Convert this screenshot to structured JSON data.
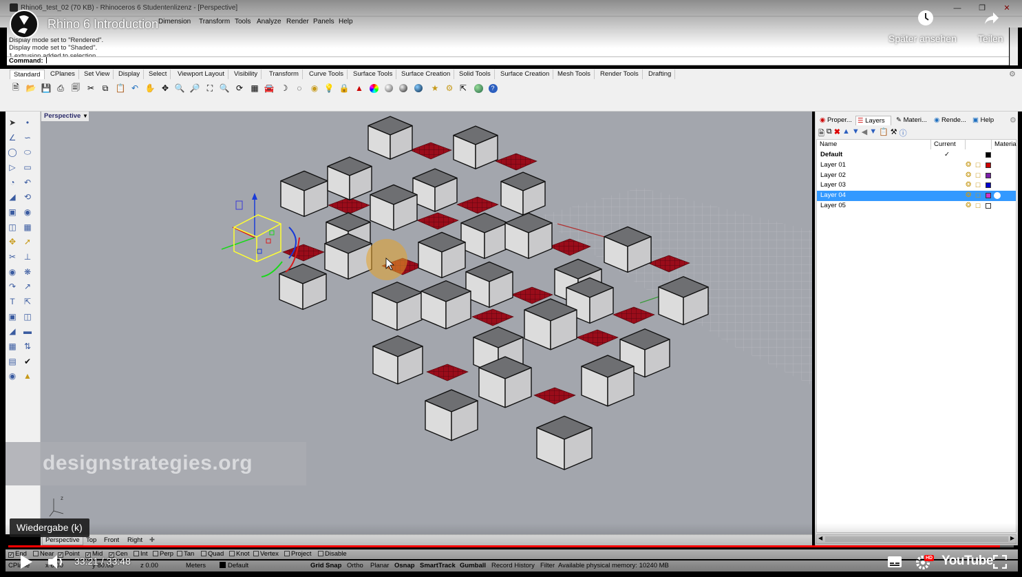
{
  "rhino": {
    "window_title": "Rhino6_test_02 (70 KB) - Rhinoceros 6 Studentenlizenz - [Perspective]",
    "menu": [
      "Dimension",
      "Transform",
      "Tools",
      "Analyze",
      "Render",
      "Panels",
      "Help"
    ],
    "command_history": [
      "Display mode set to \"Rendered\".",
      "Display mode set to \"Shaded\".",
      "1 extrusion added to selection."
    ],
    "command_label": "Command:",
    "toolbar_tabs": [
      "Standard",
      "CPlanes",
      "Set View",
      "Display",
      "Select",
      "Viewport Layout",
      "Visibility",
      "Transform",
      "Curve Tools",
      "Surface Tools",
      "Surface Creation",
      "Solid Tools",
      "Surface Creation",
      "Mesh Tools",
      "Render Tools",
      "Drafting"
    ],
    "active_toolbar_tab": "Standard",
    "viewport_label": "Perspective",
    "watermark": "designstrategies.org",
    "panel_tabs": [
      "Proper...",
      "Layers",
      "Materi...",
      "Rende...",
      "Help"
    ],
    "layer_columns": {
      "name": "Name",
      "current": "Current",
      "material": "Materia"
    },
    "layers": [
      {
        "name": "Default",
        "current": "✓",
        "color": "#000000",
        "bold": true
      },
      {
        "name": "Layer 01",
        "current": "",
        "color": "#cc0000"
      },
      {
        "name": "Layer 02",
        "current": "",
        "color": "#7a1fa8"
      },
      {
        "name": "Layer 03",
        "current": "",
        "color": "#0000cc"
      },
      {
        "name": "Layer 04",
        "current": "",
        "color": "#cc33cc",
        "selected": true
      },
      {
        "name": "Layer 05",
        "current": "",
        "color": "#ffffff"
      }
    ],
    "view_tabs": [
      "Perspective",
      "Top",
      "Front",
      "Right"
    ],
    "active_view_tab": "Perspective",
    "osnaps": [
      {
        "label": "End",
        "checked": true
      },
      {
        "label": "Near",
        "checked": false
      },
      {
        "label": "Point",
        "checked": true
      },
      {
        "label": "Mid",
        "checked": true
      },
      {
        "label": "Cen",
        "checked": true
      },
      {
        "label": "Int",
        "checked": false
      },
      {
        "label": "Perp",
        "checked": false
      },
      {
        "label": "Tan",
        "checked": false
      },
      {
        "label": "Quad",
        "checked": false
      },
      {
        "label": "Knot",
        "checked": false
      },
      {
        "label": "Vertex",
        "checked": false
      },
      {
        "label": "Project",
        "checked": false
      },
      {
        "label": "Disable",
        "checked": false
      }
    ],
    "status": {
      "cplane": "CPlane",
      "x": "x 6.00",
      "y": "y 80.03",
      "z": "z 0.00",
      "units": "Meters",
      "layer": "Default",
      "grid_snap": "Grid Snap",
      "ortho": "Ortho",
      "planar": "Planar",
      "osnap": "Osnap",
      "smarttrack": "SmartTrack",
      "gumball": "Gumball",
      "record_history": "Record History",
      "filter": "Filter",
      "memory": "Available physical memory: 10240 MB"
    }
  },
  "youtube": {
    "title": "Rhino 6 Introduction",
    "watch_later": "Später ansehen",
    "share": "Teilen",
    "tooltip": "Wiedergabe (k)",
    "time": "33:21 / 33:48",
    "progress": 0.9866,
    "logo": "YouTube",
    "hd_badge": "HD",
    "accent": "#ff0000"
  }
}
